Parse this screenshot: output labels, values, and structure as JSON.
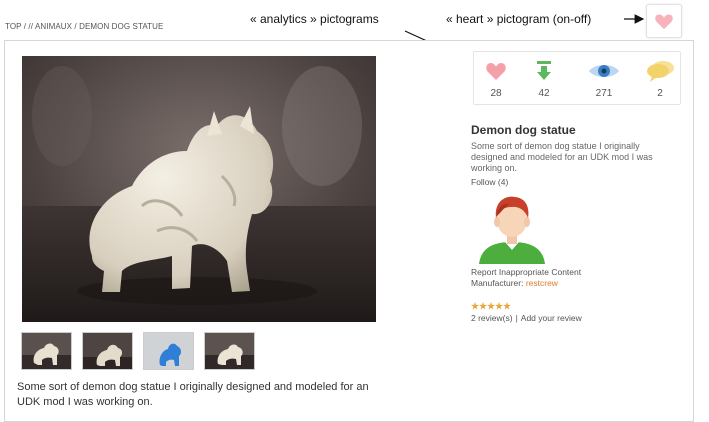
{
  "breadcrumb": "TOP / // ANIMAUX / DEMON DOG STATUE",
  "annotations": {
    "analytics": "« analytics » pictograms",
    "heart": "« heart » pictogram (on-off)"
  },
  "stats": [
    {
      "icon": "heart-icon",
      "value": "28"
    },
    {
      "icon": "download-icon",
      "value": "42"
    },
    {
      "icon": "eye-icon",
      "value": "271"
    },
    {
      "icon": "comment-icon",
      "value": "2"
    }
  ],
  "product": {
    "title": "Demon dog statue",
    "description": "Some sort of demon dog statue I originally designed and modeled for an UDK mod I was working on.",
    "follow": "Follow (4)",
    "report": "Report Inappropriate Content",
    "manufacturer_label": "Manufacturer:",
    "manufacturer": "restcrew",
    "rating": 5,
    "reviews": "2 review(s)",
    "add_review": "Add your review"
  },
  "main": {
    "description": "Some sort of demon dog statue I originally designed and modeled for an UDK mod I was working on."
  },
  "colors": {
    "heart": "#f4a0a8",
    "download": "#5cb85c",
    "eye": "#3a7fc4",
    "comment": "#f2d36b",
    "star": "#e8a53a",
    "link": "#e07b2a"
  }
}
